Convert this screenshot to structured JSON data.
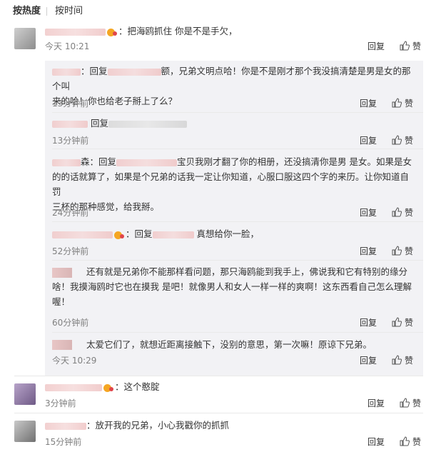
{
  "tabs": {
    "hot": "按热度",
    "time": "按时间"
  },
  "actions": {
    "reply": "回复",
    "like": "赞"
  },
  "comments": [
    {
      "text": "：把海鸥抓住 你是不是手欠，",
      "time": "今天 10:21"
    },
    {
      "text": "：这个憨腚",
      "time": "3分钟前"
    },
    {
      "text": "：放开我的兄弟，小心我戳你的抓抓",
      "time": "15分钟前"
    }
  ],
  "replies": [
    {
      "prefix": "：回复",
      "text": "额，兄弟文明点哈！你是不是刚才那个我没搞清楚是男是女的那个叫",
      "text2": "来的哈！你也给老子掰上了么？",
      "time": "13分钟前"
    },
    {
      "prefix": "回复",
      "text": "",
      "time": "13分钟前"
    },
    {
      "prefix": "森：回复",
      "text": "宝贝我刚才翻了你的相册，还没搞清你是男 是女。如果是女",
      "text2": "的的话就算了，如果是个兄弟的话我一定让你知道，心服口服这四个字的来历。让你知道自罚",
      "text3": "三杯的那种感觉，给我掰。",
      "time": "24分钟前"
    },
    {
      "prefix": "：回复",
      "text": "真想给你一脸，",
      "time": "52分钟前"
    },
    {
      "prefix": "还有就是兄弟你不能那样看问题，那只海鸥能到我手上，佛说我和它有特别的缘分",
      "text2": "啥！我摸海鸥时它也在摸我 是吧！就像男人和女人一样一样的爽啊！这东西看自己怎么理解",
      "text3": "喔！",
      "time": "60分钟前"
    },
    {
      "prefix": "太爱它们了，就想近距离接触下，没别的意思，第一次嘛！原谅下兄弟。",
      "time": "今天 10:29"
    }
  ]
}
